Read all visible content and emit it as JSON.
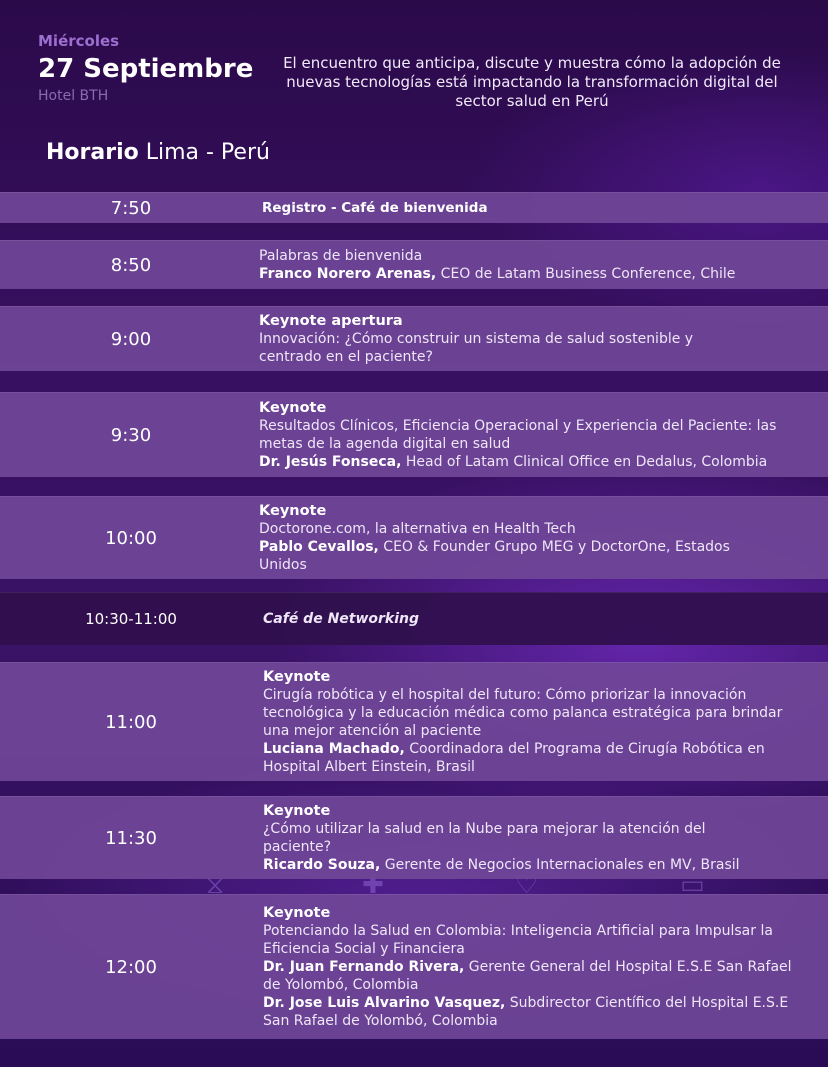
{
  "header": {
    "day": "Miércoles",
    "date": "27 Septiembre",
    "venue": "Hotel BTH",
    "tagline": "El encuentro que anticipa, discute y muestra cómo la adopción de nuevas tecnologías está impactando la transformación digital del sector salud en Perú",
    "schedule_label": "Horario",
    "schedule_zone": " Lima - Perú"
  },
  "agenda": [
    {
      "time": "7:50",
      "title": "Registro - Café de bienvenida"
    },
    {
      "time": "8:50",
      "desc": "Palabras de bienvenida",
      "speaker": "Franco Norero Arenas,",
      "role": " CEO de Latam Business Conference, Chile"
    },
    {
      "time": "9:00",
      "title": "Keynote apertura",
      "desc": "Innovación: ¿Cómo construir un sistema de salud sostenible y centrado en el paciente?"
    },
    {
      "time": "9:30",
      "title": "Keynote",
      "desc": "Resultados Clínicos, Eficiencia Operacional y Experiencia del Paciente: las metas de la agenda digital en salud",
      "speaker": "Dr. Jesús Fonseca,",
      "role": " Head of Latam Clinical Office en Dedalus, Colombia"
    },
    {
      "time": "10:00",
      "title": "Keynote",
      "desc": "Doctorone.com, la alternativa en Health Tech",
      "speaker": "Pablo Cevallos,",
      "role": " CEO & Founder Grupo MEG y DoctorOne, Estados Unidos"
    },
    {
      "time": "10:30-11:00",
      "title": "Café de Networking"
    },
    {
      "time": "11:00",
      "title": "Keynote",
      "desc": "Cirugía robótica y el hospital del futuro: Cómo priorizar la innovación tecnológica y la educación médica como palanca estratégica para brindar una mejor atención al paciente",
      "speaker": "Luciana Machado,",
      "role": " Coordinadora del Programa de Cirugía Robótica en Hospital Albert Einstein, Brasil"
    },
    {
      "time": "11:30",
      "title": "Keynote",
      "desc": "¿Cómo utilizar la salud en la Nube para mejorar la atención del paciente?",
      "speaker": "Ricardo Souza,",
      "role": "  Gerente de Negocios Internacionales en MV, Brasil"
    },
    {
      "time": "12:00",
      "title": "Keynote",
      "desc": "Potenciando la Salud en Colombia: Inteligencia Artificial para Impulsar la Eficiencia Social y Financiera",
      "speaker": "Dr. Juan Fernando Rivera,",
      "role": " Gerente General del Hospital E.S.E San Rafael de Yolombó, Colombia",
      "speaker2": "Dr. Jose Luis Alvarino Vasquez,",
      "role2": " Subdirector Científico del Hospital E.S.E San Rafael de Yolombó, Colombia"
    }
  ],
  "colors": {
    "row": "#704698",
    "row_dark": "#30104e",
    "background": "#381062",
    "accent": "#9c6fd0"
  },
  "decor_icons": [
    "dna-icon",
    "plus-icon",
    "heart-monitor-icon",
    "pill-icon"
  ]
}
